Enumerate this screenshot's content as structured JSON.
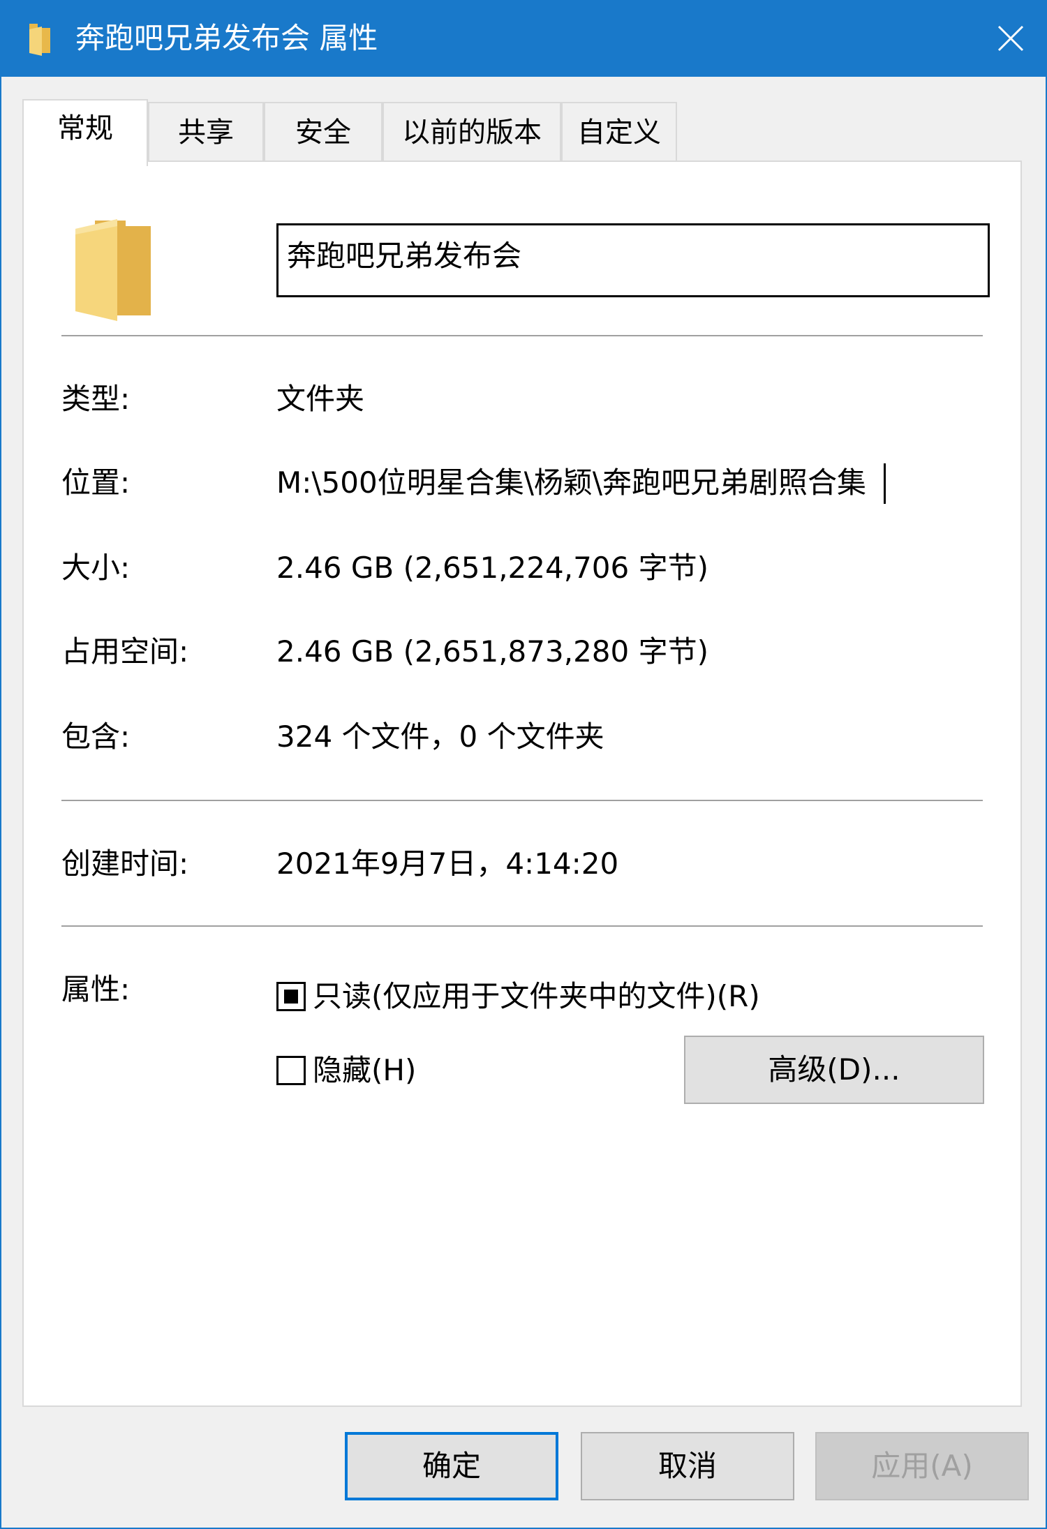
{
  "window": {
    "title": "奔跑吧兄弟发布会 属性",
    "close_icon": "close-icon",
    "folder_icon": "folder-icon",
    "accent": "#1979ca"
  },
  "tabs": [
    {
      "label": "常规",
      "active": true
    },
    {
      "label": "共享"
    },
    {
      "label": "安全"
    },
    {
      "label": "以前的版本"
    },
    {
      "label": "自定义"
    }
  ],
  "general": {
    "name_value": "奔跑吧兄弟发布会",
    "type_label": "类型:",
    "type_value": "文件夹",
    "location_label": "位置:",
    "location_value": "M:\\500位明星合集\\杨颖\\奔跑吧兄弟剧照合集",
    "size_label": "大小:",
    "size_value": "2.46 GB (2,651,224,706 字节)",
    "size_on_disk_label": "占用空间:",
    "size_on_disk_value": "2.46 GB (2,651,873,280 字节)",
    "contains_label": "包含:",
    "contains_value": "324 个文件，0 个文件夹",
    "created_label": "创建时间:",
    "created_value": "2021年9月7日，4:14:20",
    "attributes_label": "属性:",
    "readonly_label": "只读(仅应用于文件夹中的文件)(R)",
    "readonly_state": "indeterminate",
    "hidden_label": "隐藏(H)",
    "hidden_state": "unchecked",
    "advanced_label": "高级(D)..."
  },
  "footer": {
    "ok_label": "确定",
    "cancel_label": "取消",
    "apply_label": "应用(A)"
  }
}
